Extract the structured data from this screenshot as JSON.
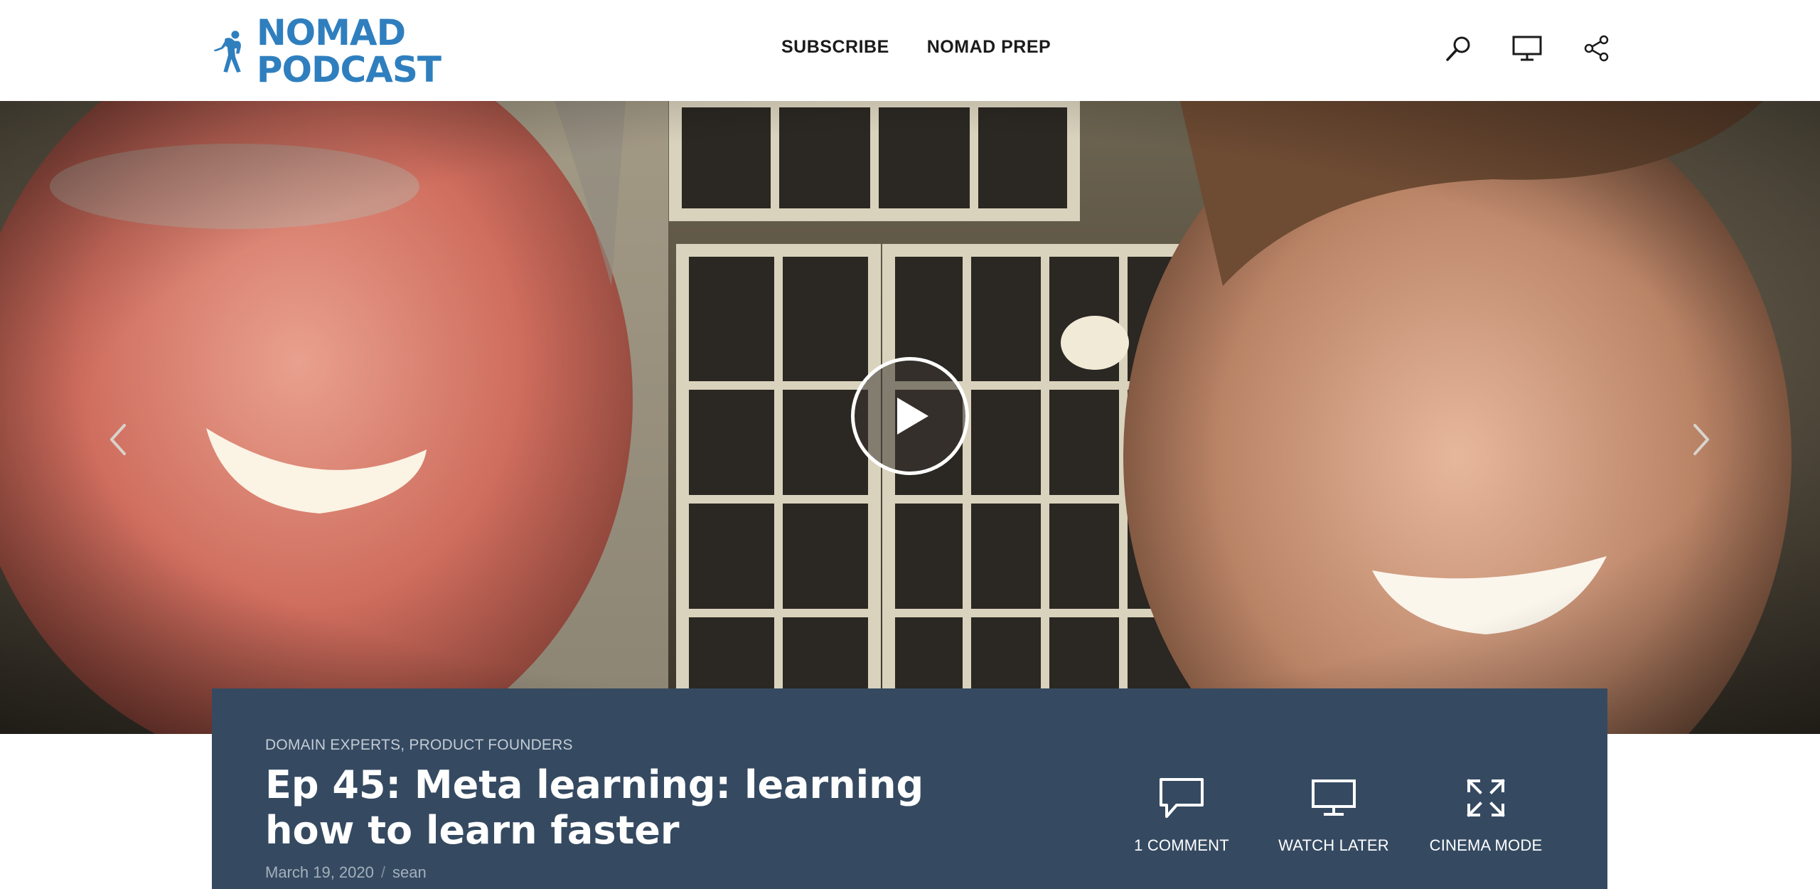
{
  "header": {
    "logo": {
      "line1": "NOMAD",
      "line2": "PODCAST",
      "color": "#2f7fbf"
    },
    "nav": [
      {
        "label": "SUBSCRIBE"
      },
      {
        "label": "NOMAD PREP"
      }
    ],
    "icons": [
      "search-icon",
      "monitor-icon",
      "share-icon"
    ]
  },
  "hero": {
    "icons": [
      "play-icon",
      "chevron-left-icon",
      "chevron-right-icon"
    ]
  },
  "episode": {
    "categories": [
      "DOMAIN EXPERTS",
      "PRODUCT FOUNDERS"
    ],
    "category_separator": ",",
    "title": "Ep 45: Meta learning: learning how to learn faster",
    "date": "March 19, 2020",
    "meta_separator": "/",
    "author": "sean",
    "panel_color": "#354a61",
    "actions": [
      {
        "label": "1 COMMENT",
        "icon": "comment-icon"
      },
      {
        "label": "WATCH LATER",
        "icon": "monitor-icon"
      },
      {
        "label": "CINEMA MODE",
        "icon": "expand-icon"
      }
    ]
  }
}
